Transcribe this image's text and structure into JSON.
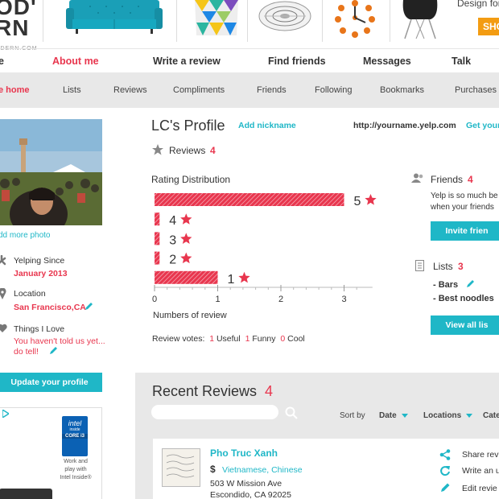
{
  "banner": {
    "logo_line1": "OD'",
    "logo_line2": "RN",
    "logo_sub": "ODERN.COM",
    "tagline": "Design for",
    "shop_label": "SHO"
  },
  "main_nav": {
    "items": [
      "e",
      "About me",
      "Write a review",
      "Find friends",
      "Messages",
      "Talk"
    ],
    "active_index": 1
  },
  "sub_nav": {
    "items": [
      "e home",
      "Lists",
      "Reviews",
      "Compliments",
      "Friends",
      "Following",
      "Bookmarks",
      "Purchases"
    ],
    "active_index": 0
  },
  "sidebar": {
    "add_photo": "dd more photo",
    "yelping_since_label": "Yelping Since",
    "yelping_since_value": "January 2013",
    "location_label": "Location",
    "location_value": "San Francisco,CA",
    "things_label": "Things I Love",
    "things_value_1": "You haven't told us yet...",
    "things_value_2": "do tell!",
    "update_button": "Update your profile",
    "ad_brand": "intel",
    "ad_inside": "inside",
    "ad_core": "CORE i3",
    "ad_text": [
      "Work and",
      "play with",
      "Intel Inside®"
    ]
  },
  "profile": {
    "title": "LC's Profile",
    "add_nickname": "Add nickname",
    "url": "http://yourname.yelp.com",
    "get_your": "Get your",
    "reviews_label": "Reviews",
    "reviews_count": "4",
    "rating_title": "Rating Distribution",
    "x_axis_label": "Numbers of review",
    "votes_label": "Review votes:",
    "votes_useful_count": "1",
    "votes_useful": "Useful",
    "votes_funny_count": "1",
    "votes_funny": "Funny",
    "votes_cool_count": "0",
    "votes_cool": "Cool"
  },
  "chart_data": {
    "type": "bar",
    "orientation": "horizontal",
    "categories": [
      "5",
      "4",
      "3",
      "2",
      "1"
    ],
    "values": [
      3,
      0.08,
      0.08,
      0.08,
      1
    ],
    "xlim": [
      0,
      3.4
    ],
    "xticks": [
      "0",
      "1",
      "2",
      "3"
    ],
    "xlabel": "Numbers of review",
    "bar_color": "#e8364e",
    "grid": false
  },
  "friends": {
    "label": "Friends",
    "count": "4",
    "text_1": "Yelp is so much be",
    "text_2": "when your friends",
    "button": "Invite frien"
  },
  "lists": {
    "label": "Lists",
    "count": "3",
    "items": [
      "- Bars",
      "- Best noodles"
    ],
    "button": "View all lis"
  },
  "recent_reviews": {
    "title": "Recent Reviews",
    "count": "4",
    "sort_by": "Sort by",
    "sort_options": [
      "Date",
      "Locations",
      "Cate"
    ],
    "review": {
      "name": "Pho Truc Xanh",
      "price": "$",
      "category": "Vietnamese, Chinese",
      "address_1": "503 W Mission Ave",
      "address_2": "Escondido, CA 92025"
    },
    "actions": [
      "Share revi",
      "Write an u",
      "Edit revie"
    ]
  },
  "colors": {
    "accent": "#e8364e",
    "teal": "#1fb7c7",
    "panel": "#e8e8e8"
  }
}
